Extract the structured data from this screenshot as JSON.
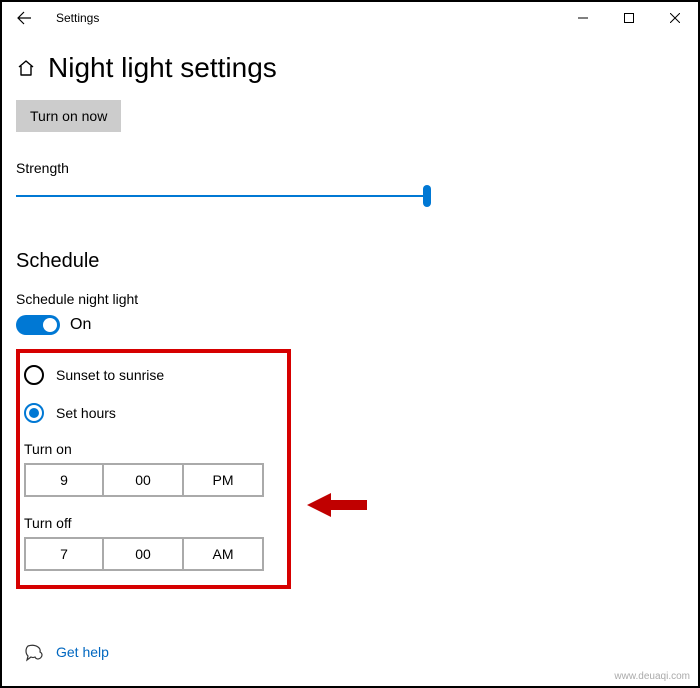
{
  "window": {
    "app_title": "Settings"
  },
  "header": {
    "page_title": "Night light settings"
  },
  "controls": {
    "turn_on_now": "Turn on now",
    "strength_label": "Strength",
    "strength_value": 99
  },
  "schedule": {
    "heading": "Schedule",
    "toggle_label": "Schedule night light",
    "toggle_state_text": "On",
    "toggle_on": true,
    "radio_options": {
      "sunset_label": "Sunset to sunrise",
      "sethours_label": "Set hours",
      "selected": "set_hours"
    },
    "turn_on": {
      "label": "Turn on",
      "hour": "9",
      "minute": "00",
      "ampm": "PM"
    },
    "turn_off": {
      "label": "Turn off",
      "hour": "7",
      "minute": "00",
      "ampm": "AM"
    }
  },
  "footer": {
    "help_link": "Get help",
    "watermark": "www.deuaqi.com"
  }
}
